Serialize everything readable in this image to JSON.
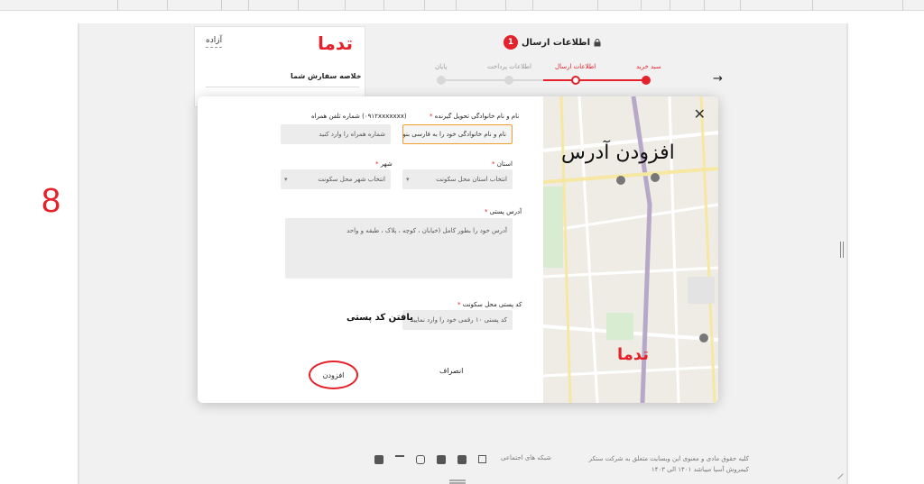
{
  "app": {
    "brand": "ﺗﺪﻣﺎ",
    "overlay_step": "8"
  },
  "sidebar": {
    "user_label": "آزاده",
    "summary_title": "خلاصه سفارش شما"
  },
  "checkout": {
    "title": "اطلاعات ارسال",
    "badge": "1",
    "steps": [
      "سبد خرید",
      "اطلاعات ارسال",
      "اطلاعات پرداخت",
      "پایان"
    ]
  },
  "modal": {
    "map_title": "افزودن آدرس",
    "recipient_label": "نام و نام خانوادگی تحویل گیرنده",
    "recipient_value": "نام و نام خانوادگی خود را به فارسی بنویسید",
    "phone_label": "شماره تلفن همراه (۰۹۱۲xxxxxxx)",
    "phone_placeholder": "شماره همراه را وارد کنید",
    "province_label": "استان",
    "province_placeholder": "انتخاب استان محل سکونت",
    "city_label": "شهر",
    "city_placeholder": "انتخاب شهر محل سکونت",
    "address_label": "آدرس پستی",
    "address_placeholder": "آدرس خود را بطور کامل (خیابان ، کوچه ، پلاک ، طبقه و واحد",
    "postal_label": "کد پستی محل سکونت",
    "postal_placeholder": "کد پستی ۱۰ رقمی خود را وارد نمایید",
    "find_postal": "یافتن کد پستی",
    "cancel": "انصراف",
    "submit": "افزودن"
  },
  "footer": {
    "copyright_line1": "کلیه حقوق مادی و معنوی این وبسایت متعلق به شرکت ستکر",
    "copyright_line2": "کیمروش آسیا میباشد ۱۴۰۱ الی ۱۴۰۳",
    "social_label": "شبکه های اجتماعی"
  },
  "colors": {
    "accent": "#e5212a",
    "focus": "#f0a030"
  }
}
